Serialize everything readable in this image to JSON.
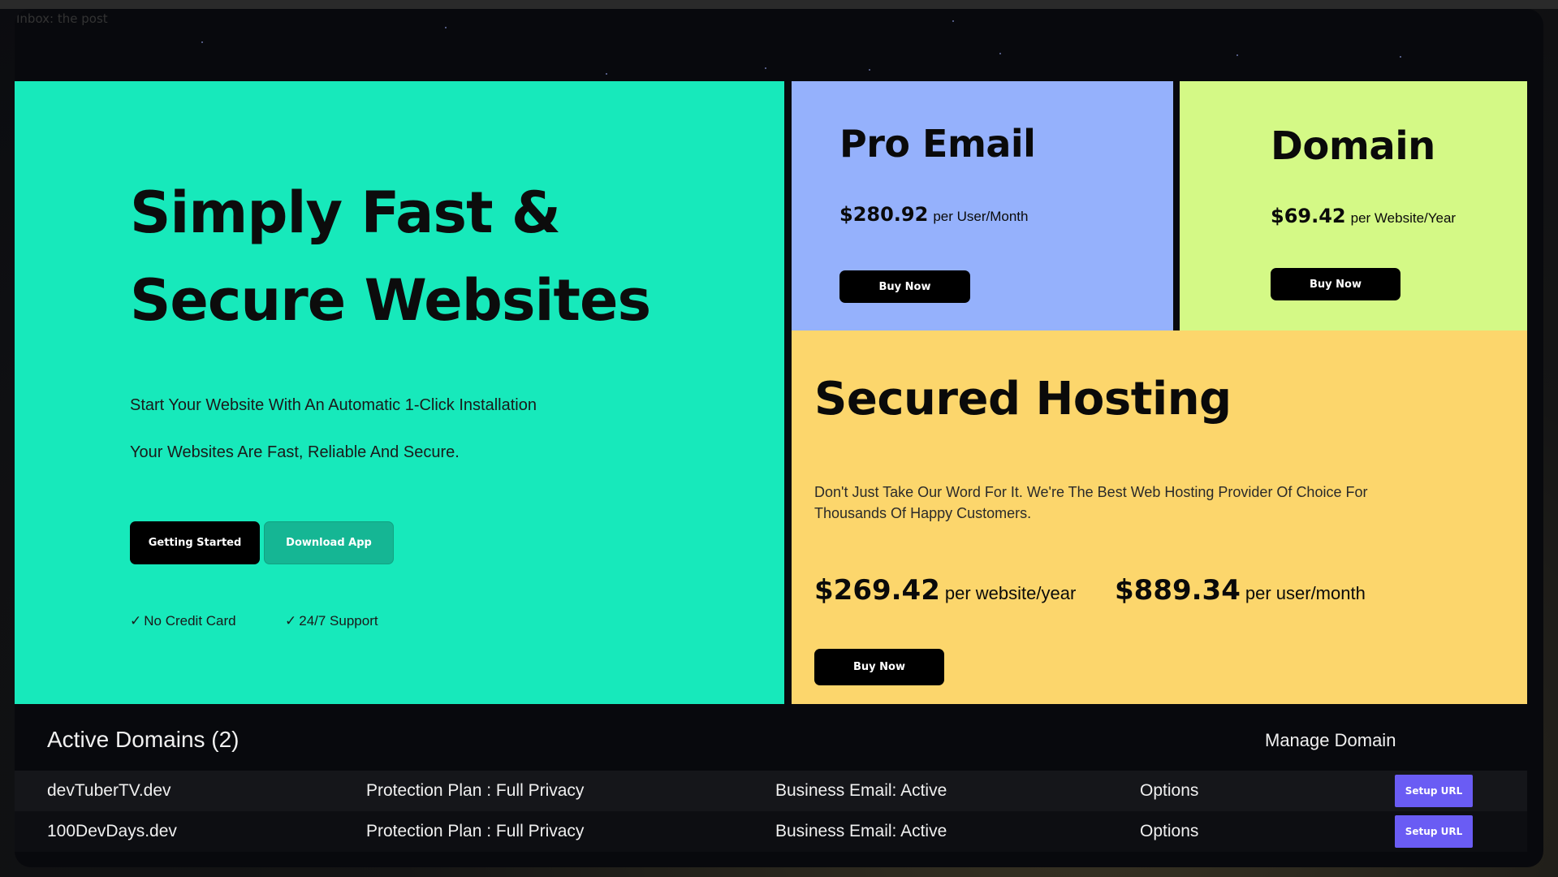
{
  "corner_text": "Inbox: the post",
  "hero": {
    "title_line1": "Simply Fast &",
    "title_line2": "Secure Websites",
    "line1": "Start Your Website With An Automatic 1-Click Installation",
    "line2": "Your Websites Are Fast, Reliable And Secure.",
    "primary_button": "Getting Started",
    "secondary_button": "Download App",
    "perks": [
      "No Credit Card",
      "24/7 Support"
    ],
    "check_glyph": "✓"
  },
  "pro_email": {
    "title": "Pro Email",
    "price": "$280.92",
    "unit": "per User/Month",
    "button": "Buy Now"
  },
  "domain": {
    "title": "Domain",
    "price": "$69.42",
    "unit": "per Website/Year",
    "button": "Buy Now"
  },
  "hosting": {
    "title": "Secured Hosting",
    "description": "Don't Just Take Our Word For It. We're The Best Web Hosting Provider Of Choice For Thousands Of Happy Customers.",
    "price1": "$269.42",
    "unit1": "per website/year",
    "price2": "$889.34",
    "unit2": "per user/month",
    "button": "Buy Now"
  },
  "domains": {
    "heading": "Active Domains (2)",
    "manage": "Manage Domain",
    "rows": [
      {
        "name": "devTuberTV.dev",
        "protection": "Protection Plan : Full Privacy",
        "email": "Business Email: Active",
        "options": "Options",
        "action": "Setup URL"
      },
      {
        "name": "100DevDays.dev",
        "protection": "Protection Plan : Full Privacy",
        "email": "Business Email: Active",
        "options": "Options",
        "action": "Setup URL"
      }
    ]
  },
  "colors": {
    "hero": "#17e9bb",
    "pro_email": "#95b1fc",
    "domain": "#d4f986",
    "hosting": "#fcd66c",
    "setup_button": "#6a5cf4"
  }
}
